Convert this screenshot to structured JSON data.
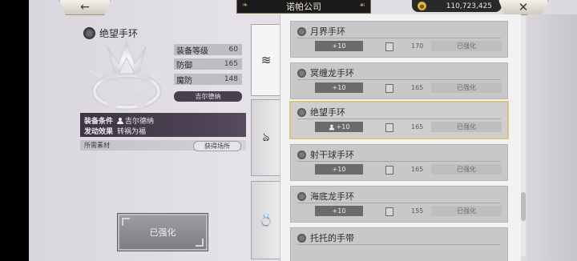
{
  "top_bar": {
    "back_icon": "←",
    "title": "诺帕公司",
    "currency": "110,723,425",
    "close_icon": "✕"
  },
  "item": {
    "name": "绝望手环",
    "stats": [
      {
        "label": "装备等级",
        "value": "60"
      },
      {
        "label": "防御",
        "value": "165"
      },
      {
        "label": "魔防",
        "value": "148"
      }
    ],
    "owner": "吉尔德纳",
    "requirement_label": "装备条件",
    "requirement_value": "吉尔德纳",
    "effect_label": "发动效果",
    "effect_value": "转祸为福",
    "materials_label": "所需素材",
    "materials_button": "获得场所",
    "enhanced_button": "已强化"
  },
  "tabs": [
    {
      "name": "spring-coil-icon",
      "glyph": "≋"
    },
    {
      "name": "necklace-icon",
      "glyph": "ঌ"
    },
    {
      "name": "ring-icon",
      "glyph": "💍"
    }
  ],
  "list": [
    {
      "name": "月界手环",
      "level": "+10",
      "owner_icon": false,
      "value": "170",
      "state": "已强化",
      "selected": false
    },
    {
      "name": "冥缠龙手环",
      "level": "+10",
      "owner_icon": false,
      "value": "165",
      "state": "已强化",
      "selected": false
    },
    {
      "name": "绝望手环",
      "level": "+10",
      "owner_icon": true,
      "value": "165",
      "state": "已强化",
      "selected": true
    },
    {
      "name": "射干球手环",
      "level": "+10",
      "owner_icon": false,
      "value": "165",
      "state": "已强化",
      "selected": false
    },
    {
      "name": "海底龙手环",
      "level": "+10",
      "owner_icon": false,
      "value": "155",
      "state": "已强化",
      "selected": false
    },
    {
      "name": "托托的手带",
      "level": "",
      "owner_icon": false,
      "value": "",
      "state": "",
      "selected": false
    }
  ],
  "colors": {
    "selected_border": "#d7c486",
    "effect_box": "#4b4152"
  }
}
